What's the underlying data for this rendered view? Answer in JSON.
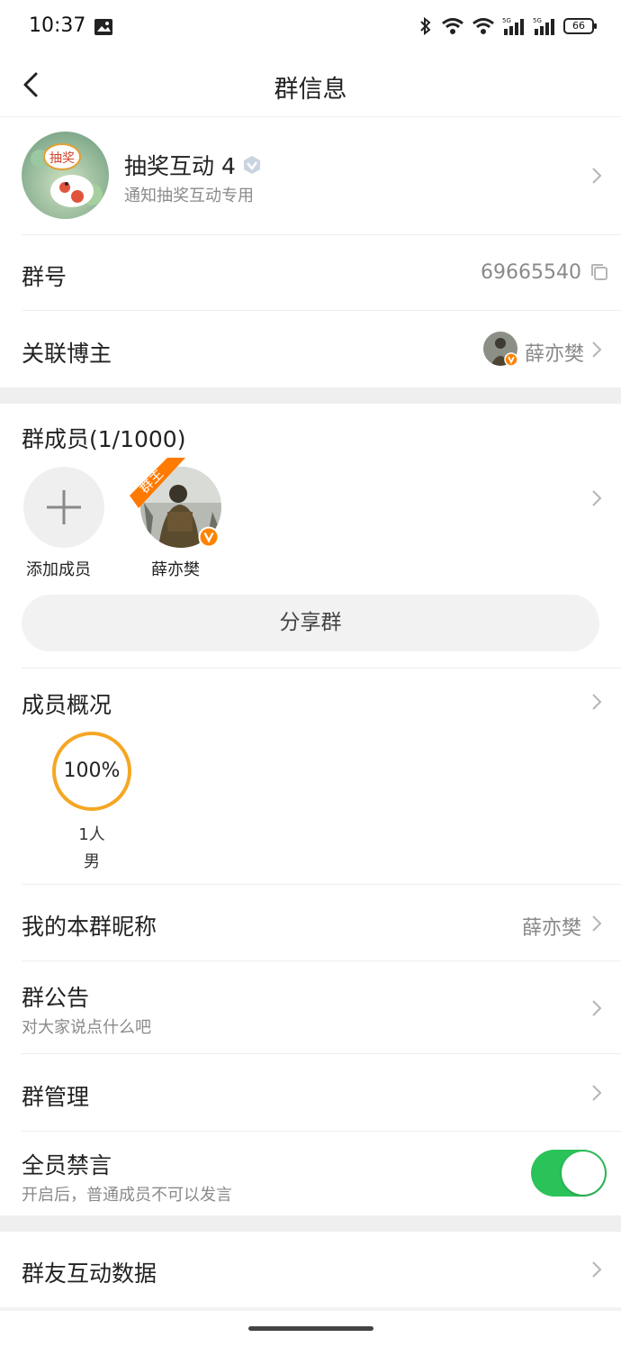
{
  "status_bar": {
    "time": "10:37",
    "battery": "66",
    "network_labels": [
      "5G",
      "5G"
    ]
  },
  "header": {
    "title": "群信息"
  },
  "group": {
    "name": "抽奖互动 4",
    "subtitle": "通知抽奖互动专用",
    "avatar_text": "抽奖"
  },
  "group_number": {
    "label": "群号",
    "value": "69665540"
  },
  "linked_blogger": {
    "label": "关联博主",
    "name": "薛亦樊"
  },
  "members": {
    "title": "群成员(1/1000)",
    "add_label": "添加成员",
    "owner_badge": "群主",
    "owner_name": "薛亦樊"
  },
  "share_button": "分享群",
  "overview": {
    "title": "成员概况",
    "percent": "100%",
    "count": "1人",
    "gender": "男",
    "ring_fraction": 1.0
  },
  "nickname": {
    "label": "我的本群昵称",
    "value": "薛亦樊"
  },
  "announcement": {
    "label": "群公告",
    "sub": "对大家说点什么吧"
  },
  "management": {
    "label": "群管理"
  },
  "mute_all": {
    "label": "全员禁言",
    "sub": "开启后，普通成员不可以发言",
    "enabled": true
  },
  "interaction_data": {
    "label": "群友互动数据"
  },
  "colors": {
    "accent_orange": "#f5a623",
    "toggle_green": "#2ac35a",
    "badge_orange": "#ff7a00"
  }
}
